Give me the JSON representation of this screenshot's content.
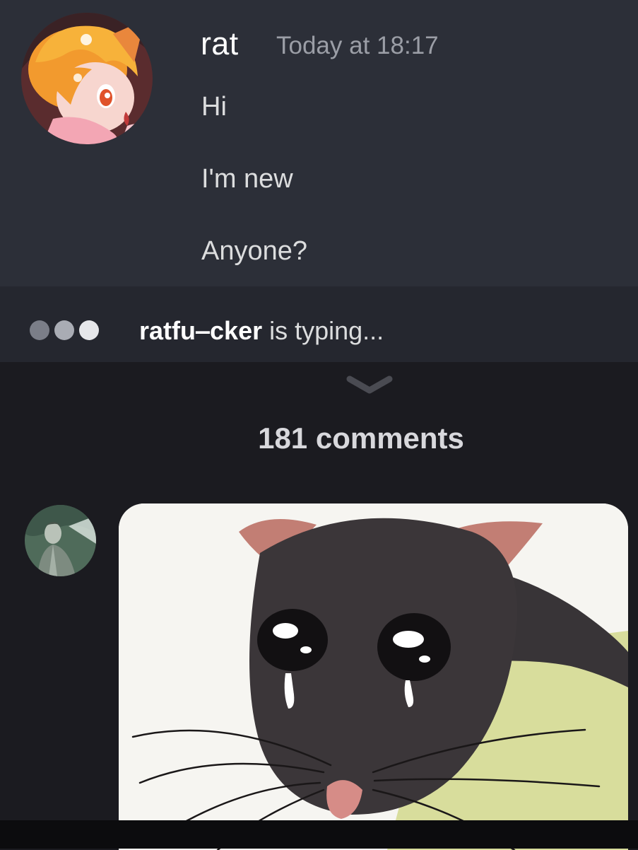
{
  "message": {
    "username": "rat",
    "timestamp": "Today at 18:17",
    "lines": [
      "Hi",
      "I'm new",
      "Anyone?"
    ]
  },
  "typing": {
    "name": "ratfu‒cker",
    "suffix": " is typing..."
  },
  "comments": {
    "count_label": "181 comments"
  },
  "icons": {
    "expand": "chevron-down-icon",
    "typing": "typing-dots-icon"
  },
  "colors": {
    "chat_background": "#2c2f38",
    "typing_bar": "#25272f",
    "page_background": "#1b1b20",
    "username": "#ffffff",
    "timestamp": "#9b9ea6"
  }
}
